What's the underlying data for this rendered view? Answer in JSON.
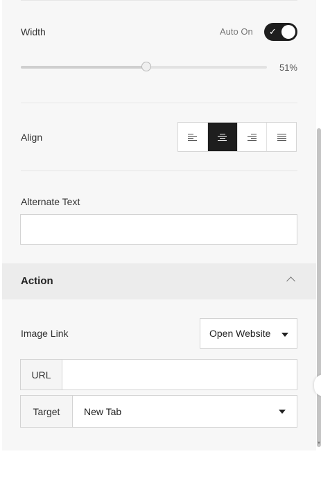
{
  "width_setting": {
    "label": "Width",
    "auto_label": "Auto On",
    "auto_enabled": true,
    "slider_value_percent": 51,
    "slider_value_text": "51%"
  },
  "align_setting": {
    "label": "Align",
    "options": [
      "left",
      "center",
      "right",
      "justify"
    ],
    "selected": "center"
  },
  "alt_text": {
    "label": "Alternate Text",
    "value": ""
  },
  "action_section": {
    "title": "Action",
    "expanded": true,
    "image_link": {
      "label": "Image Link",
      "selected": "Open Website"
    },
    "url": {
      "label": "URL",
      "value": ""
    },
    "target": {
      "label": "Target",
      "selected": "New Tab"
    }
  },
  "colors": {
    "toggle_on": "#1e1e1e",
    "active_align": "#1e1e1e",
    "section_header_bg": "#ececec"
  }
}
